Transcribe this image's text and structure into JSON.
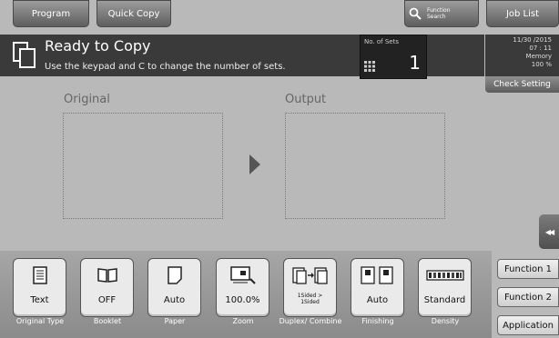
{
  "tabs": {
    "program": "Program",
    "quick_copy": "Quick Copy",
    "function_search": "Function Search",
    "job_list": "Job List"
  },
  "status": {
    "title": "Ready to Copy",
    "message": "Use the keypad and C to change the number of sets."
  },
  "sets": {
    "label": "No. of Sets",
    "value": "1"
  },
  "info": {
    "date": "11/30 /2015",
    "time": "07 : 11",
    "memory_label": "Memory",
    "memory_value": "100 %"
  },
  "check_setting": "Check Setting",
  "sections": {
    "original": "Original",
    "output": "Output"
  },
  "functions": [
    {
      "value": "Text",
      "label": "Original Type",
      "icon": "document-text-icon"
    },
    {
      "value": "OFF",
      "label": "Booklet",
      "icon": "book-icon"
    },
    {
      "value": "Auto",
      "label": "Paper",
      "icon": "paper-icon"
    },
    {
      "value": "100.0%",
      "label": "Zoom",
      "icon": "zoom-icon"
    },
    {
      "value": "1Sided > 1Sided",
      "label": "Duplex/ Combine",
      "icon": "duplex-icon"
    },
    {
      "value": "Auto",
      "label": "Finishing",
      "icon": "finishing-icon"
    },
    {
      "value": "Standard",
      "label": "Density",
      "icon": "density-icon"
    }
  ],
  "side_tabs": {
    "function1": "Function 1",
    "function2": "Function 2",
    "application": "Application"
  },
  "collapse_glyph": "◀◀"
}
